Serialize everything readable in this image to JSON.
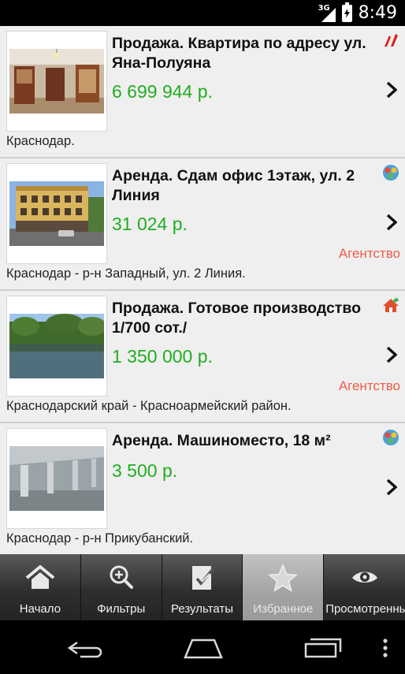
{
  "status_bar": {
    "network": "3G",
    "time": "8:49"
  },
  "listings": [
    {
      "title": "Продажа. Квартира по адресу ул. Яна-Полуяна",
      "price": "6 699 944 р.",
      "location": "Краснодар.",
      "agency": "",
      "badge_icon": "private-owner-icon",
      "photo": "apartment-interior-photo"
    },
    {
      "title": "Аренда. Сдам офис 1этаж, ул. 2 Линия",
      "price": "31 024 р.",
      "location": "Краснодар - р-н Западный, ул. 2 Линия.",
      "agency": "Агентство",
      "badge_icon": "commercial-property-icon",
      "photo": "office-building-photo"
    },
    {
      "title": "Продажа. Готовое производство 1/700 сот./",
      "price": "1 350 000 р.",
      "location": "Краснодарский край - Красноармейский район.",
      "agency": "Агентство",
      "badge_icon": "land-house-icon",
      "photo": "lake-trees-photo"
    },
    {
      "title": "Аренда. Машиноместо, 18 м²",
      "price": "3 500 р.",
      "location": "Краснодар - р-н Прикубанский.",
      "agency": "",
      "badge_icon": "commercial-property-icon",
      "photo": "parking-garage-photo"
    }
  ],
  "tabs": [
    {
      "label": "Начало",
      "icon": "home-icon",
      "active": false
    },
    {
      "label": "Фильтры",
      "icon": "magnifier-plus-icon",
      "active": false
    },
    {
      "label": "Результаты",
      "icon": "checklist-icon",
      "active": false
    },
    {
      "label": "Избранное",
      "icon": "star-icon",
      "active": true
    },
    {
      "label": "Просмотренные",
      "icon": "eye-icon",
      "active": false
    }
  ],
  "colors": {
    "price": "#1fae1f",
    "agency": "#ef5b4a",
    "list_background": "#efefef",
    "tab_active": "#a3a3a3"
  },
  "nav_bar": {
    "buttons": [
      "back-icon",
      "home-icon",
      "recent-apps-icon",
      "menu-icon"
    ]
  }
}
